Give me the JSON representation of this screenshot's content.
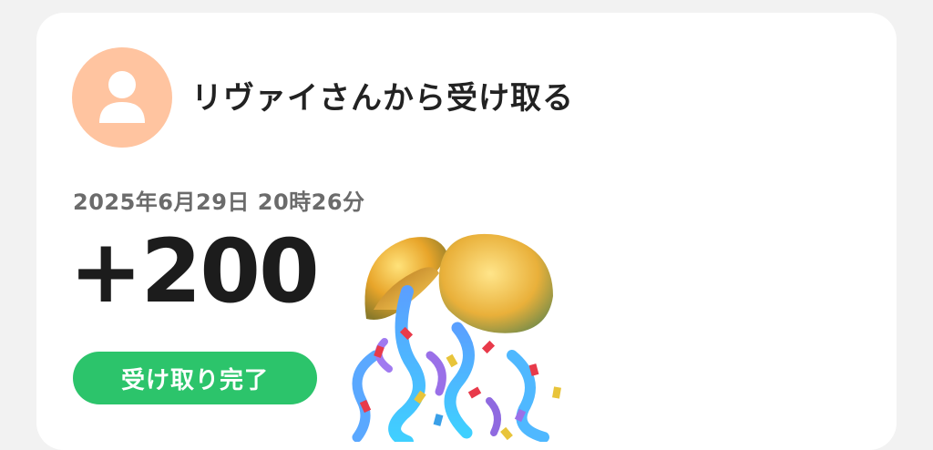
{
  "receipt": {
    "sender_title": "リヴァイさんから受け取る",
    "datetime": "2025年6月29日 20時26分",
    "amount": "+200",
    "status": "受け取り完了"
  },
  "icons": {
    "avatar": "person-icon",
    "celebration": "party-ball-icon"
  },
  "colors": {
    "avatar_bg": "#ffc4a0",
    "status_green": "#2cc46b"
  }
}
